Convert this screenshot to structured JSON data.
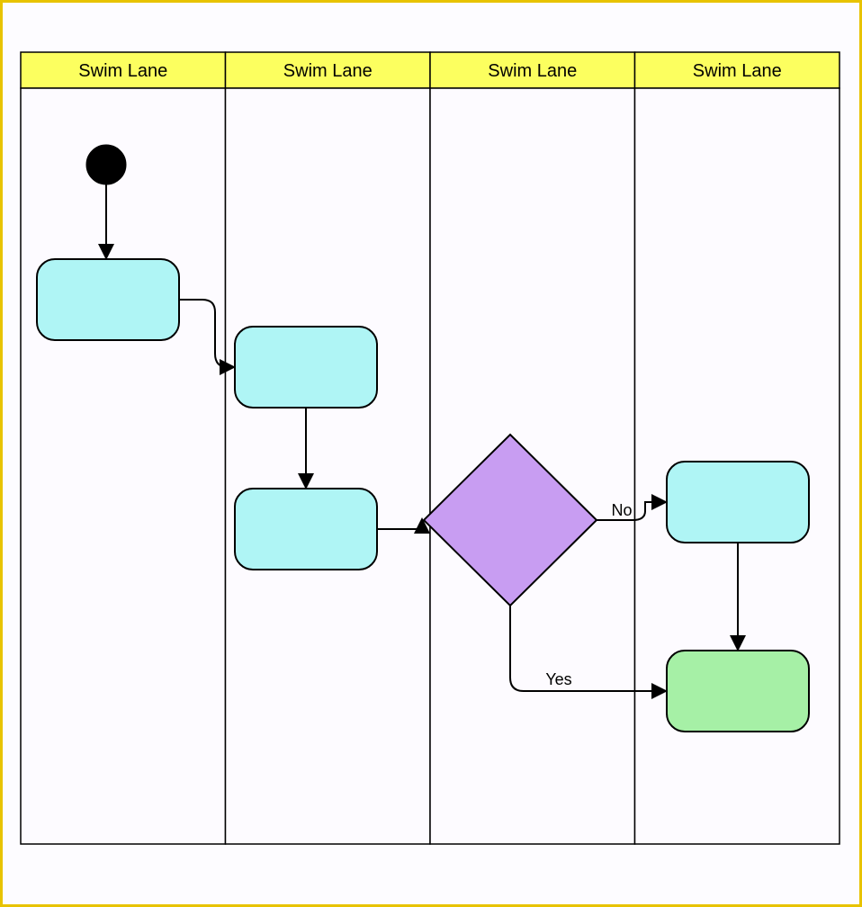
{
  "lanes": {
    "lane1": {
      "header": "Swim Lane"
    },
    "lane2": {
      "header": "Swim Lane"
    },
    "lane3": {
      "header": "Swim Lane"
    },
    "lane4": {
      "header": "Swim Lane"
    }
  },
  "nodes": {
    "start": {
      "type": "start",
      "lane": "lane1",
      "label": ""
    },
    "p1": {
      "type": "process",
      "lane": "lane1",
      "label": ""
    },
    "p2": {
      "type": "process",
      "lane": "lane2",
      "label": ""
    },
    "p3": {
      "type": "process",
      "lane": "lane2",
      "label": ""
    },
    "d1": {
      "type": "decision",
      "lane": "lane3",
      "label": ""
    },
    "p4": {
      "type": "process",
      "lane": "lane4",
      "label": ""
    },
    "p5": {
      "type": "process-green",
      "lane": "lane4",
      "label": ""
    }
  },
  "edges": {
    "e_start_p1": {
      "from": "start",
      "to": "p1",
      "label": ""
    },
    "e_p1_p2": {
      "from": "p1",
      "to": "p2",
      "label": ""
    },
    "e_p2_p3": {
      "from": "p2",
      "to": "p3",
      "label": ""
    },
    "e_p3_d1": {
      "from": "p3",
      "to": "d1",
      "label": ""
    },
    "e_d1_p4": {
      "from": "d1",
      "to": "p4",
      "label": "No"
    },
    "e_d1_p5": {
      "from": "d1",
      "to": "p5",
      "label": "Yes"
    },
    "e_p4_p5": {
      "from": "p4",
      "to": "p5",
      "label": ""
    }
  },
  "colors": {
    "frameBorder": "#e8c300",
    "laneHeader": "#fcff5f",
    "laneBody": "#fdfbff",
    "process": "#aff5f5",
    "processGreen": "#a6f0a6",
    "decision": "#c89df2",
    "start": "#000000",
    "connector": "#000000"
  },
  "watermark": ""
}
